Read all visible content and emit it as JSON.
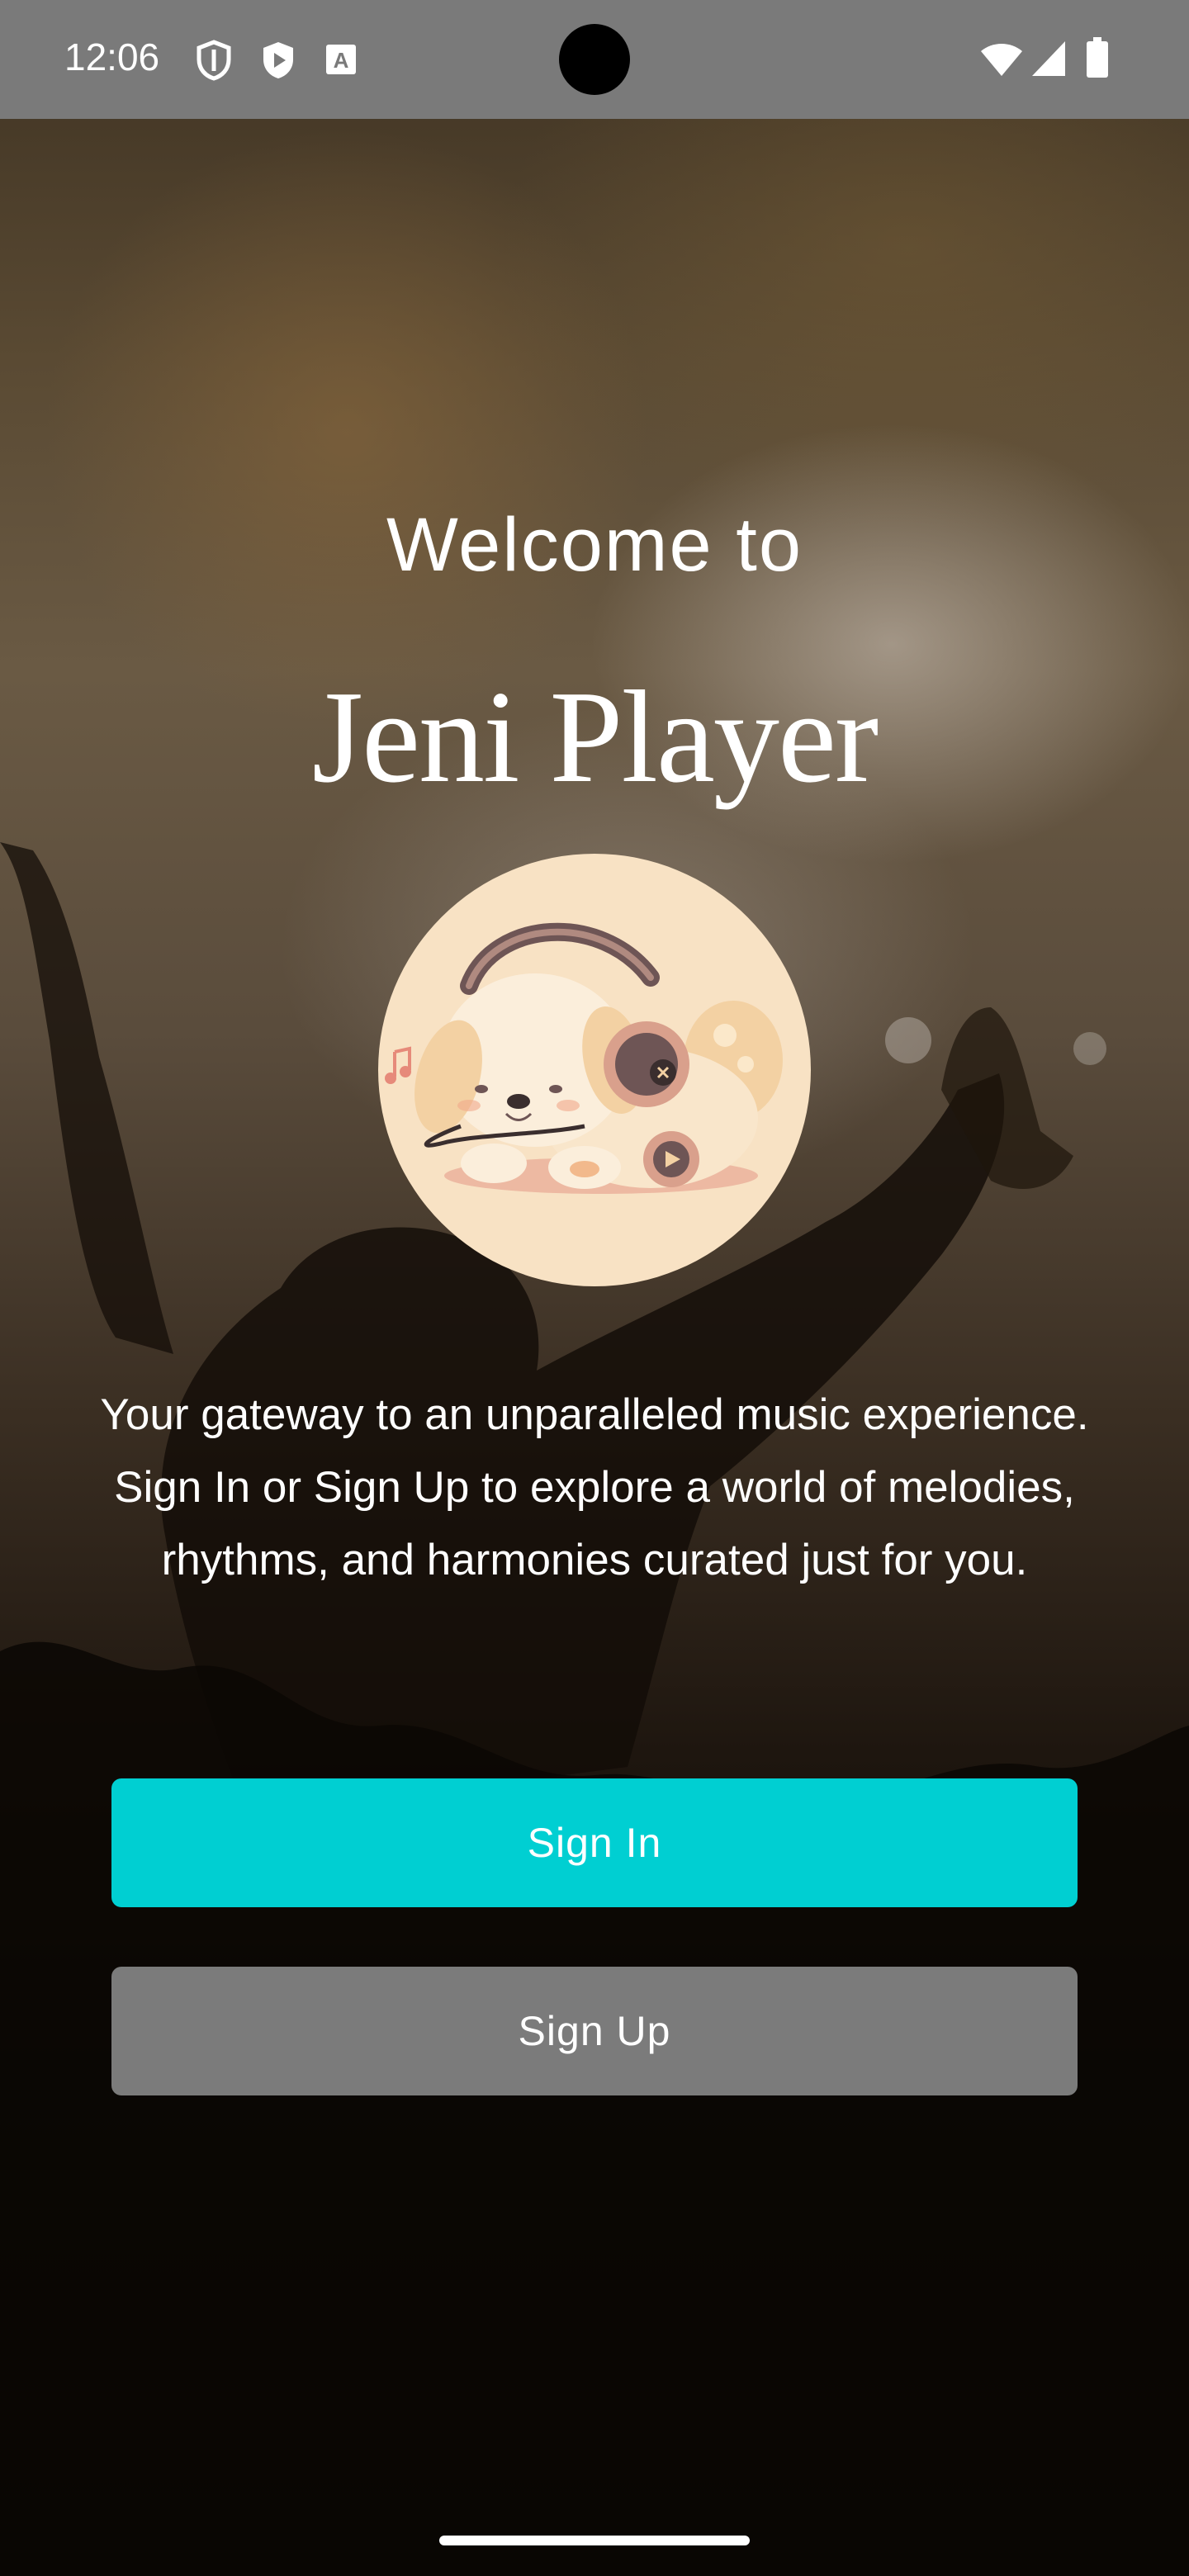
{
  "status_bar": {
    "time": "12:06",
    "icons": [
      "shield-icon",
      "play-protect-icon",
      "font-a-icon",
      "wifi-icon",
      "signal-icon",
      "battery-icon"
    ]
  },
  "welcome_screen": {
    "welcome_text": "Welcome to",
    "app_name": "Jeni Player",
    "mascot_image": "puppy-with-headphones-illustration",
    "tagline": "Your gateway to an unparalleled music experience. Sign In or Sign Up to explore a world of melodies, rhythms, and harmonies curated just for you.",
    "sign_in_label": "Sign In",
    "sign_up_label": "Sign Up"
  },
  "colors": {
    "sign_in": "#00cfd2",
    "sign_up": "#7b7b7b",
    "status_bar": "#7a7a7a",
    "avatar_bg": "#f8e2c4"
  }
}
